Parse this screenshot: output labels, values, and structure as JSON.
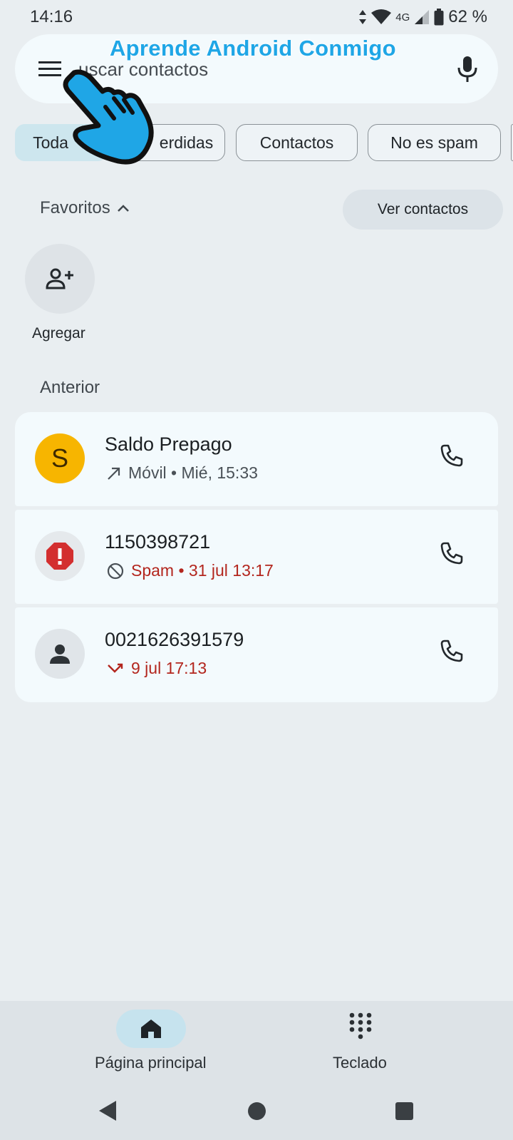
{
  "status_bar": {
    "time": "14:16",
    "network": "4G",
    "battery": "62 %"
  },
  "search": {
    "placeholder": "Buscar contactos",
    "visible_text": "uscar contactos"
  },
  "watermark": "Aprende Android Conmigo",
  "filters": [
    {
      "label": "Toda",
      "selected": true
    },
    {
      "label": "erdidas",
      "selected": false
    },
    {
      "label": "Contactos",
      "selected": false
    },
    {
      "label": "No es spam",
      "selected": false
    }
  ],
  "favorites": {
    "label": "Favoritos",
    "view_contacts": "Ver contactos",
    "add_label": "Agregar"
  },
  "history": {
    "section_label": "Anterior",
    "calls": [
      {
        "initial": "S",
        "name": "Saldo Prepago",
        "detail": "Móvil • Mié, 15:33",
        "type": "outgoing"
      },
      {
        "name": "1150398721",
        "detail": "Spam • 31 jul 13:17",
        "type": "spam"
      },
      {
        "name": "0021626391579",
        "detail": "9 jul 17:13",
        "type": "missed"
      }
    ]
  },
  "bottom_nav": {
    "home_label": "Página principal",
    "keypad_label": "Teclado"
  },
  "colors": {
    "accent_yellow": "#F7B500",
    "spam_red": "#D32F2F",
    "selected_chip": "#CDE6EE",
    "watermark_blue": "#1FA6E6"
  }
}
